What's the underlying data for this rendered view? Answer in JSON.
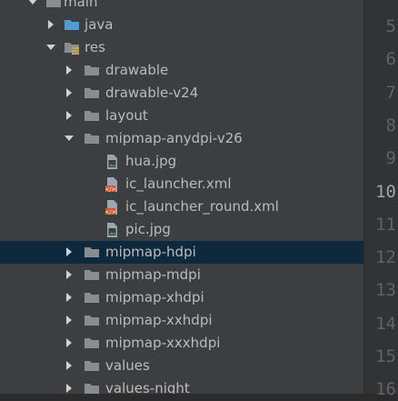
{
  "project_tree": {
    "items": [
      {
        "label": "main",
        "depth": 0,
        "expanded": true,
        "icon": "folder-icon"
      },
      {
        "label": "java",
        "depth": 1,
        "expanded": false,
        "icon": "source-folder-icon"
      },
      {
        "label": "res",
        "depth": 1,
        "expanded": true,
        "icon": "resource-folder-icon"
      },
      {
        "label": "drawable",
        "depth": 2,
        "expanded": false,
        "icon": "folder-icon"
      },
      {
        "label": "drawable-v24",
        "depth": 2,
        "expanded": false,
        "icon": "folder-icon"
      },
      {
        "label": "layout",
        "depth": 2,
        "expanded": false,
        "icon": "folder-icon"
      },
      {
        "label": "mipmap-anydpi-v26",
        "depth": 2,
        "expanded": true,
        "icon": "folder-icon"
      },
      {
        "label": "hua.jpg",
        "depth": 3,
        "icon": "image-file-icon"
      },
      {
        "label": "ic_launcher.xml",
        "depth": 3,
        "icon": "xml-file-icon"
      },
      {
        "label": "ic_launcher_round.xml",
        "depth": 3,
        "icon": "xml-file-icon"
      },
      {
        "label": "pic.jpg",
        "depth": 3,
        "icon": "image-file-icon"
      },
      {
        "label": "mipmap-hdpi",
        "depth": 2,
        "expanded": false,
        "icon": "folder-icon",
        "selected": true
      },
      {
        "label": "mipmap-mdpi",
        "depth": 2,
        "expanded": false,
        "icon": "folder-icon"
      },
      {
        "label": "mipmap-xhdpi",
        "depth": 2,
        "expanded": false,
        "icon": "folder-icon"
      },
      {
        "label": "mipmap-xxhdpi",
        "depth": 2,
        "expanded": false,
        "icon": "folder-icon"
      },
      {
        "label": "mipmap-xxxhdpi",
        "depth": 2,
        "expanded": false,
        "icon": "folder-icon"
      },
      {
        "label": "values",
        "depth": 2,
        "expanded": false,
        "icon": "folder-icon"
      },
      {
        "label": "values-night",
        "depth": 2,
        "expanded": false,
        "icon": "folder-icon"
      }
    ]
  },
  "editor_gutter": {
    "line_numbers": [
      "5",
      "6",
      "7",
      "8",
      "9",
      "10",
      "11",
      "12",
      "13",
      "14",
      "15",
      "16"
    ],
    "current_line": "10"
  },
  "colors": {
    "tree_background": "#3c3f41",
    "selected_row": "#0d293e",
    "text": "#bbbbbb",
    "folder": "#8a8d8f",
    "source_folder": "#4b9fd5",
    "xml_badge": "#cc5a36",
    "image_file": "#5b8a5e"
  }
}
